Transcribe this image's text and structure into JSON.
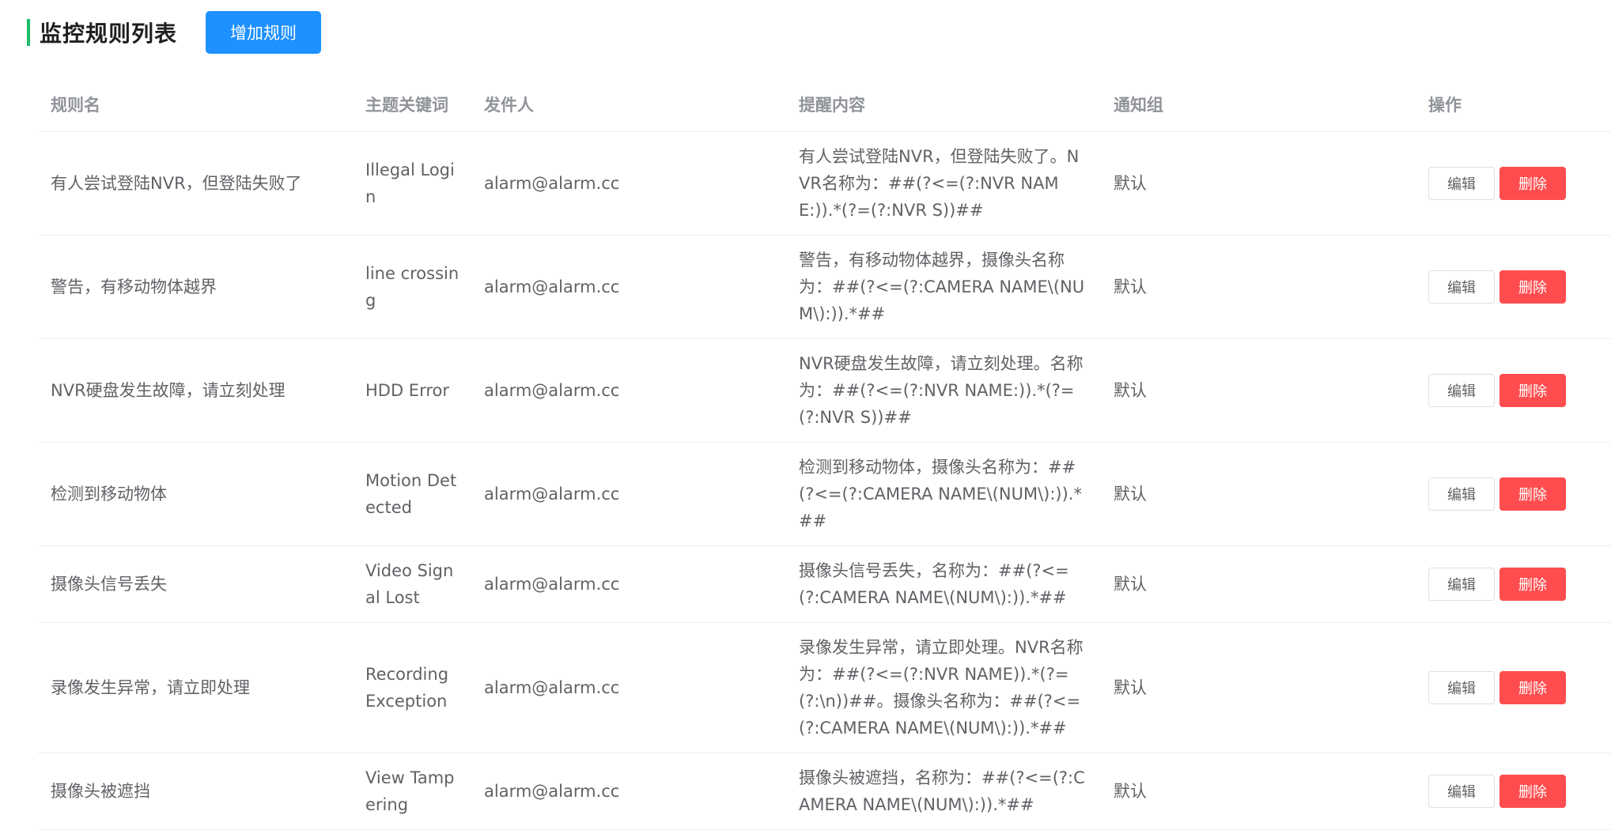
{
  "page": {
    "title": "监控规则列表",
    "add_button_label": "增加规则"
  },
  "table": {
    "headers": {
      "name": "规则名",
      "keyword": "主题关键词",
      "sender": "发件人",
      "content": "提醒内容",
      "group": "通知组",
      "ops": "操作"
    },
    "rows": [
      {
        "name": "有人尝试登陆NVR，但登陆失败了",
        "keyword": "Illegal Login",
        "sender": "alarm@alarm.cc",
        "content": "有人尝试登陆NVR，但登陆失败了。NVR名称为：##(?<=(?:NVR NAME:)).*(?=(?:NVR S))##",
        "group": "默认",
        "edit_label": "编辑",
        "delete_label": "删除"
      },
      {
        "name": "警告，有移动物体越界",
        "keyword": "line crossing",
        "sender": "alarm@alarm.cc",
        "content": "警告，有移动物体越界，摄像头名称为：##(?<=(?:CAMERA NAME\\(NUM\\):)).*##",
        "group": "默认",
        "edit_label": "编辑",
        "delete_label": "删除"
      },
      {
        "name": "NVR硬盘发生故障，请立刻处理",
        "keyword": "HDD Error",
        "sender": "alarm@alarm.cc",
        "content": "NVR硬盘发生故障，请立刻处理。名称为：##(?<=(?:NVR NAME:)).*(?=(?:NVR S))##",
        "group": "默认",
        "edit_label": "编辑",
        "delete_label": "删除"
      },
      {
        "name": "检测到移动物体",
        "keyword": "Motion Detected",
        "sender": "alarm@alarm.cc",
        "content": "检测到移动物体，摄像头名称为：##(?<=(?:CAMERA NAME\\(NUM\\):)).*##",
        "group": "默认",
        "edit_label": "编辑",
        "delete_label": "删除"
      },
      {
        "name": "摄像头信号丢失",
        "keyword": "Video Signal Lost",
        "sender": "alarm@alarm.cc",
        "content": "摄像头信号丢失，名称为：##(?<=(?:CAMERA NAME\\(NUM\\):)).*##",
        "group": "默认",
        "edit_label": "编辑",
        "delete_label": "删除"
      },
      {
        "name": "录像发生异常，请立即处理",
        "keyword": "Recording Exception",
        "sender": "alarm@alarm.cc",
        "content": "录像发生异常，请立即处理。NVR名称为：##(?<=(?:NVR NAME)).*(?=(?:\\n))##。摄像头名称为：##(?<=(?:CAMERA NAME\\(NUM\\):)).*##",
        "group": "默认",
        "edit_label": "编辑",
        "delete_label": "删除"
      },
      {
        "name": "摄像头被遮挡",
        "keyword": "View Tampering",
        "sender": "alarm@alarm.cc",
        "content": "摄像头被遮挡，名称为：##(?<=(?:CAMERA NAME\\(NUM\\):)).*##",
        "group": "默认",
        "edit_label": "编辑",
        "delete_label": "删除"
      }
    ]
  },
  "colors": {
    "title_accent": "#19be6b",
    "primary": "#1e90ff",
    "danger": "#ff4d4f"
  }
}
